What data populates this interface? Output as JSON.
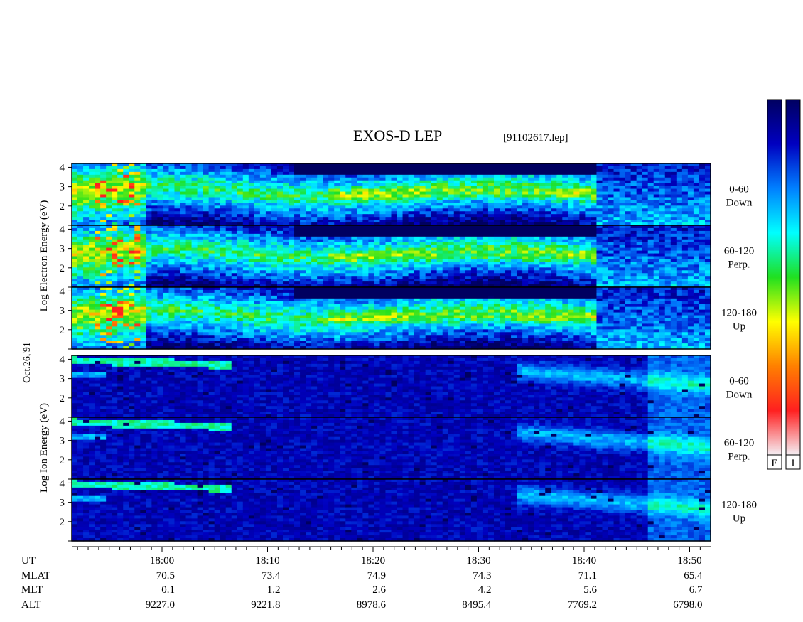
{
  "title": "EXOS-D LEP",
  "subtitle": "[91102617.lep]",
  "date_label": "Oct.26,'91",
  "colorbar_labels": [
    "E",
    "I"
  ],
  "colors": {
    "background": "#ffffff",
    "colormap": [
      "#f5f0f5",
      "#ff2020",
      "#ff8000",
      "#ffff00",
      "#20e020",
      "#00ffff",
      "#0080ff",
      "#0000c0",
      "#000060"
    ]
  },
  "chart_data": [
    {
      "type": "heatmap",
      "group_label": "Log Electron Energy (eV)",
      "y_ticks": [
        "1",
        "2",
        "3",
        "4"
      ],
      "ylim": [
        1,
        4.2
      ],
      "panels": [
        {
          "name": "0-60",
          "sub": "Down"
        },
        {
          "name": "60-120",
          "sub": "Perp."
        },
        {
          "name": "120-180",
          "sub": "Up"
        }
      ]
    },
    {
      "type": "heatmap",
      "group_label": "Log Ion Energy (eV)",
      "y_ticks": [
        "1",
        "2",
        "3",
        "4"
      ],
      "ylim": [
        1,
        4.2
      ],
      "panels": [
        {
          "name": "0-60",
          "sub": "Down"
        },
        {
          "name": "60-120",
          "sub": "Perp."
        },
        {
          "name": "120-180",
          "sub": "Up"
        }
      ]
    }
  ],
  "axis": {
    "row_labels": [
      "UT",
      "MLAT",
      "MLT",
      "ALT"
    ],
    "columns": [
      {
        "ut": "18:00",
        "mlat": "70.5",
        "mlt": "0.1",
        "alt": "9227.0"
      },
      {
        "ut": "18:10",
        "mlat": "73.4",
        "mlt": "1.2",
        "alt": "9221.8"
      },
      {
        "ut": "18:20",
        "mlat": "74.9",
        "mlt": "2.6",
        "alt": "8978.6"
      },
      {
        "ut": "18:30",
        "mlat": "74.3",
        "mlt": "4.2",
        "alt": "8495.4"
      },
      {
        "ut": "18:40",
        "mlat": "71.1",
        "mlt": "5.6",
        "alt": "7769.2"
      },
      {
        "ut": "18:50",
        "mlat": "65.4",
        "mlt": "6.7",
        "alt": "6798.0"
      }
    ]
  }
}
